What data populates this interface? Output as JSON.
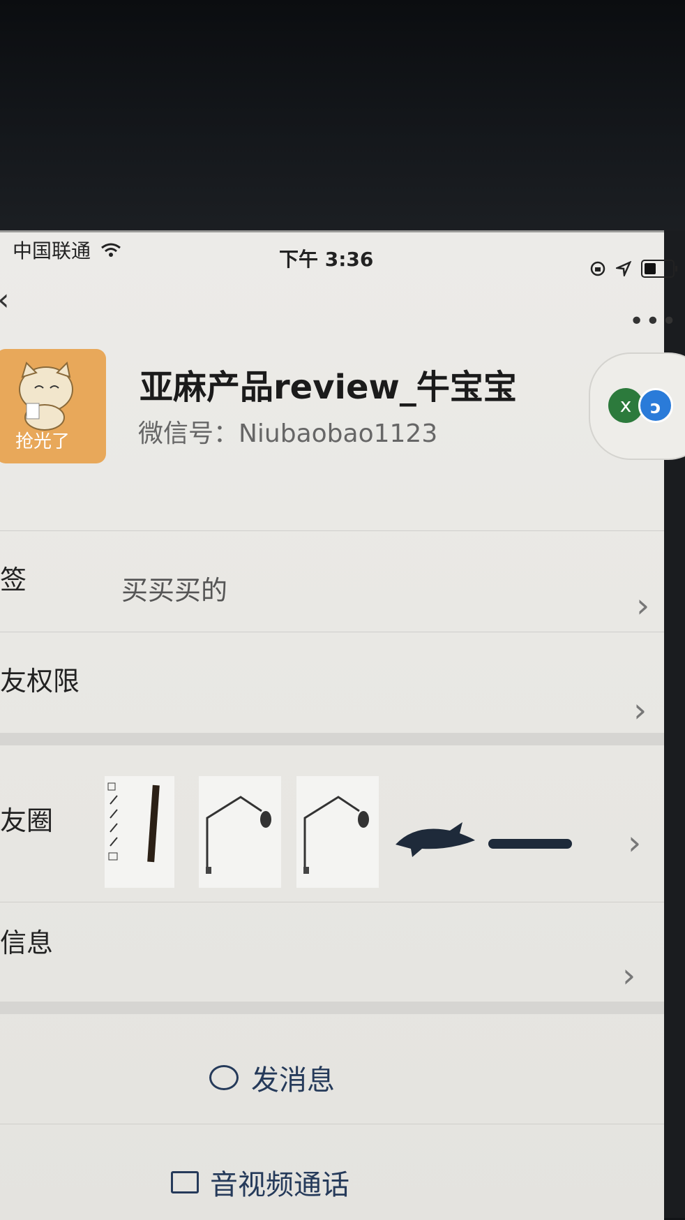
{
  "status": {
    "carrier": "中国联通",
    "time": "下午 3:36"
  },
  "profile": {
    "name": "亚麻产品review_牛宝宝",
    "wechat_id": "微信号：Niubaobao1123",
    "avatar_caption": "抢光了"
  },
  "rows": [
    {
      "label": "签",
      "value": "买买买的"
    },
    {
      "label": "友权限",
      "value": ""
    },
    {
      "label": "友圈",
      "value": ""
    },
    {
      "label": "信息",
      "value": ""
    }
  ],
  "actions": {
    "message": "发消息",
    "call": "音视频通话"
  },
  "icons": {
    "back": "chevron-left-icon",
    "more": "more-dots-icon",
    "chevron": "chevron-right-icon"
  },
  "colors": {
    "avatar_bg": "#e8a85a",
    "action_text": "#253a5a"
  }
}
